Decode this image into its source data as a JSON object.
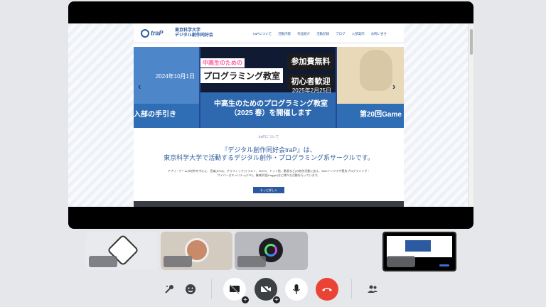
{
  "site": {
    "logo_text": "traP",
    "logo_sub_1": "東京科学大学",
    "logo_sub_2": "デジタル創作同好会",
    "nav": [
      "traPについて",
      "活動内容",
      "作品紹介",
      "活動記録",
      "ブログ",
      "入部案内",
      "お問い合せ"
    ]
  },
  "carousel": {
    "slide1": {
      "date": "2024年10月1日",
      "title": "入部の手引き"
    },
    "slide2": {
      "chip_small": "中高生のための",
      "chip_large": "プログラミング教室",
      "badge1": "参加費無料",
      "badge2": "初心者歓迎",
      "date": "2025年2月25日",
      "title": "中高生のためのプログラミング教室（2025 春）を開催します"
    },
    "slide3": {
      "title": "第20回Game"
    },
    "prev_label": "‹",
    "next_label": "›"
  },
  "about": {
    "kicker": "traPについて",
    "heading_1": "『デジタル創作同好会traP』は、",
    "heading_2": "東京科学大学で活動するデジタル創作・プログラミング系サークルです。",
    "body_1": "アプリ・ゲームの制作を中心に、音楽(DTM)、グラフィック(イラスト、3DCG、ドット絵、動画など)の創作活動に加え、Webインフラや競技プログラミング・",
    "body_2": "サイバーセキュリティ(CTF)、機械学習(Kaggle)など様々な活動を行っています。",
    "more_label": "もっと詳しく"
  },
  "controls": {
    "emoji_icon": "emoji-icon",
    "present_icon": "present-icon",
    "camera_icon": "camera-off-icon",
    "mic_icon": "mic-icon",
    "hangup_icon": "hangup-icon",
    "people_icon": "people-icon"
  },
  "colors": {
    "accent": "#2c5aa0",
    "hangup": "#ea4335"
  }
}
